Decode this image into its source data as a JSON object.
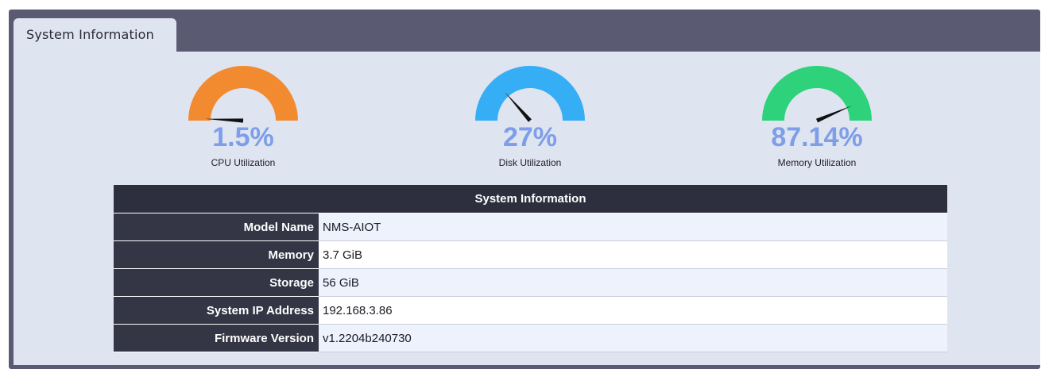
{
  "tab": {
    "label": "System Information"
  },
  "gauges": [
    {
      "id": "cpu",
      "value": 1.5,
      "value_text": "1.5%",
      "label": "CPU Utilization",
      "color": "#f28b30"
    },
    {
      "id": "disk",
      "value": 27,
      "value_text": "27%",
      "label": "Disk Utilization",
      "color": "#35aef5"
    },
    {
      "id": "memory",
      "value": 87.14,
      "value_text": "87.14%",
      "label": "Memory Utilization",
      "color": "#2ed27a"
    }
  ],
  "table": {
    "title": "System Information",
    "rows": [
      {
        "key": "Model Name",
        "value": "NMS-AIOT"
      },
      {
        "key": "Memory",
        "value": "3.7 GiB"
      },
      {
        "key": "Storage",
        "value": "56 GiB"
      },
      {
        "key": "System IP Address",
        "value": "192.168.3.86"
      },
      {
        "key": "Firmware Version",
        "value": "v1.2204b240730"
      }
    ]
  },
  "colors": {
    "frame": "#5a5b73",
    "panel": "#dfe4f1",
    "header": "#2e2f3e",
    "value_text": "#7d9ee8"
  }
}
